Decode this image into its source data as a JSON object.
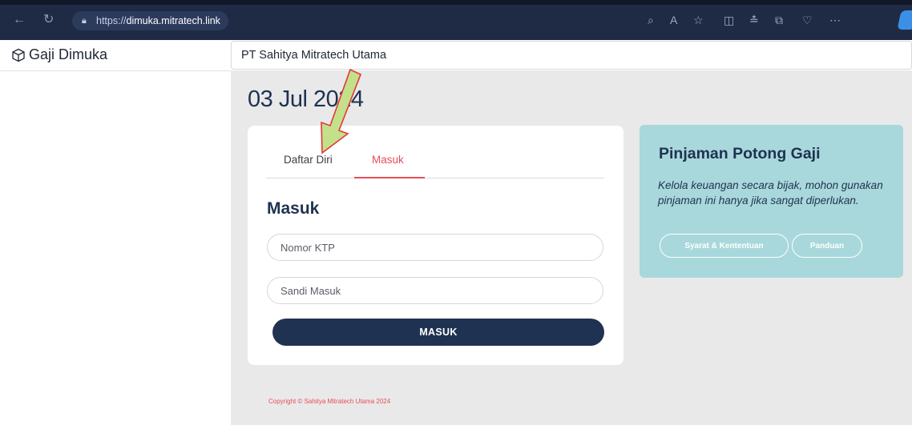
{
  "browser": {
    "url_prefix": "https://",
    "url_host": "dimuka.mitratech.link"
  },
  "app": {
    "brand": "Gaji Dimuka",
    "company": "PT Sahitya Mitratech Utama"
  },
  "main": {
    "date": "03 Jul 2024"
  },
  "tabs": {
    "daftar": "Daftar Diri",
    "masuk": "Masuk"
  },
  "form": {
    "title": "Masuk",
    "ktp_placeholder": "Nomor KTP",
    "sandi_placeholder": "Sandi Masuk",
    "submit": "MASUK"
  },
  "info": {
    "title": "Pinjaman Potong Gaji",
    "text": "Kelola keuangan secara bijak, mohon gunakan pinjaman ini hanya jika sangat diperlukan.",
    "syarat_button": "Syarat & Kententuan",
    "panduan_button": "Panduan"
  },
  "footer": {
    "copyright": "Copyright © Sahitya Mitratech Utama 2024"
  },
  "colors": {
    "navy": "#1f3251",
    "accent_red": "#e84d57",
    "info_teal": "#a8d8db",
    "arrow_green": "#c4e08a"
  }
}
